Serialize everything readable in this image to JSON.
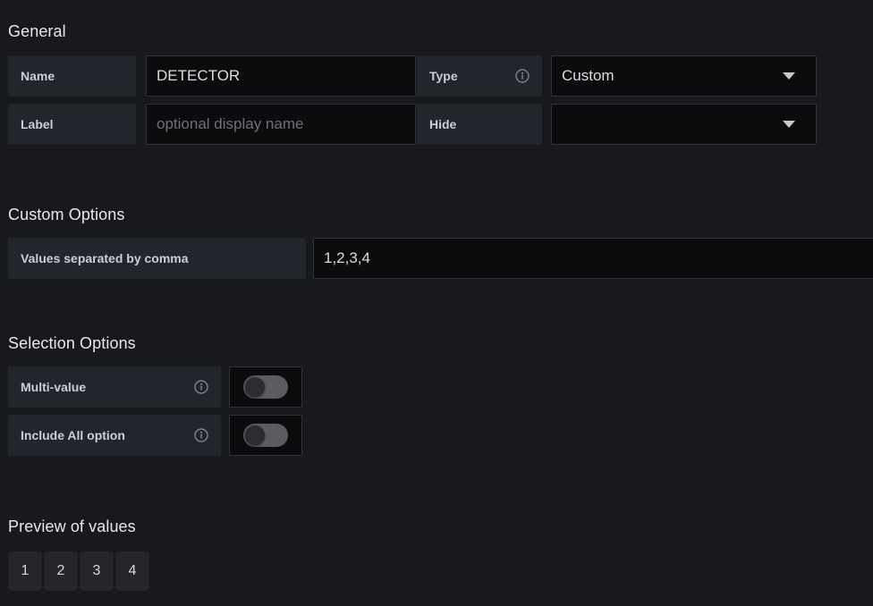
{
  "sections": {
    "general": {
      "title": "General",
      "rows": [
        {
          "label": "Name",
          "value": "DETECTOR",
          "placeholder": "",
          "right_label": "Type",
          "right_value": "Custom",
          "right_has_info": true
        },
        {
          "label": "Label",
          "value": "",
          "placeholder": "optional display name",
          "right_label": "Hide",
          "right_value": "",
          "right_has_info": false
        }
      ]
    },
    "custom_options": {
      "title": "Custom Options",
      "label": "Values separated by comma",
      "value": "1,2,3,4"
    },
    "selection_options": {
      "title": "Selection Options",
      "items": [
        {
          "label": "Multi-value",
          "has_info": true,
          "enabled": false
        },
        {
          "label": "Include All option",
          "has_info": true,
          "enabled": false
        }
      ]
    },
    "preview": {
      "title": "Preview of values",
      "values": [
        "1",
        "2",
        "3",
        "4"
      ]
    }
  },
  "icons": {
    "info": "info-circle-icon",
    "caret": "chevron-down-icon"
  },
  "colors": {
    "background": "#18191d",
    "label_background": "#22252b",
    "input_background": "#0b0c0e",
    "border": "#2f3338",
    "text": "#d8d9da",
    "placeholder": "#6e7077",
    "toggle_track_off": "#5a5c60",
    "toggle_knob_off": "#2b2c2f",
    "chip_background": "#24262b"
  }
}
